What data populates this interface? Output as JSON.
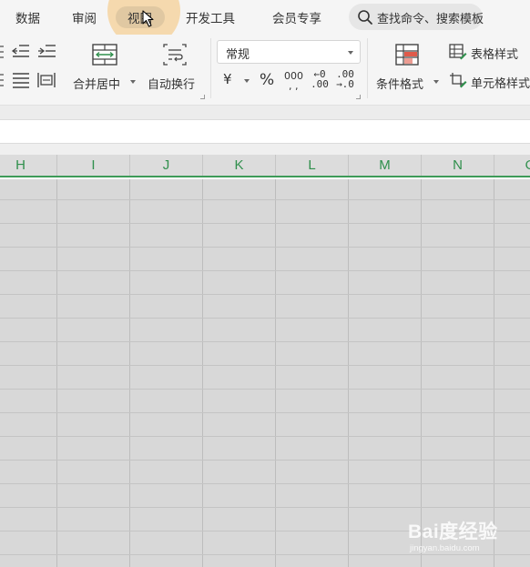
{
  "menu": {
    "tabs": [
      {
        "label": "数据"
      },
      {
        "label": "审阅"
      },
      {
        "label": "视图"
      },
      {
        "label": "开发工具"
      },
      {
        "label": "会员专享"
      }
    ],
    "active_tab": "视图",
    "search_placeholder": "查找命令、搜索模板"
  },
  "ribbon": {
    "merge_center_label": "合并居中",
    "auto_wrap_label": "自动换行",
    "number_format_value": "常规",
    "currency_symbol": "¥",
    "percent_symbol": "%",
    "thousands_symbol": "000",
    "increase_decimal": {
      "top": "←0",
      "bottom": ".00"
    },
    "decrease_decimal": {
      "top": ".00",
      "bottom": "→.0"
    },
    "conditional_format_label": "条件格式",
    "table_style_label": "表格样式",
    "cell_style_label": "单元格样式"
  },
  "sheet": {
    "column_headers": [
      "H",
      "I",
      "J",
      "K",
      "L",
      "M",
      "N",
      "O"
    ]
  },
  "watermark": {
    "main": "Bai度经验",
    "sub": "jingyan.baidu.com"
  },
  "colors": {
    "header_text": "#2f8f4c",
    "header_underline": "#3e9b58",
    "tab_highlight": "#f5d6a6",
    "grid_fill": "#d8d8d8"
  }
}
